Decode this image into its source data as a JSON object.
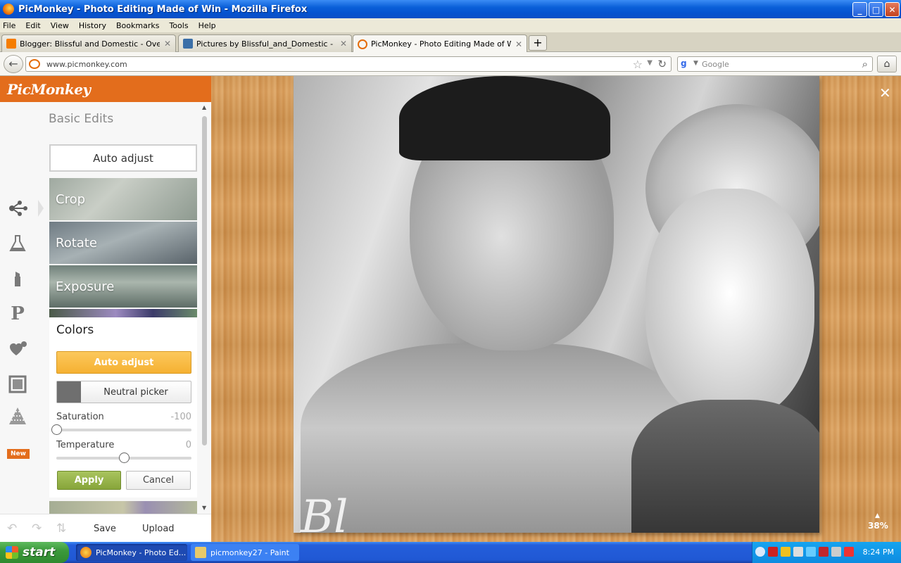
{
  "window": {
    "title": "PicMonkey - Photo Editing Made of Win - Mozilla Firefox",
    "minimize": "_",
    "maximize": "□",
    "close": "✕"
  },
  "menubar": [
    "File",
    "Edit",
    "View",
    "History",
    "Bookmarks",
    "Tools",
    "Help"
  ],
  "tabs": [
    {
      "label": "Blogger: Blissful and Domestic - Overview",
      "icon_color": "#f57d00",
      "close": "✕"
    },
    {
      "label": "Pictures by Blissful_and_Domestic - Phot...",
      "icon_color": "#3b6fa8",
      "close": "✕"
    },
    {
      "label": "PicMonkey - Photo Editing Made of Win",
      "icon_color": "#e46c0a",
      "close": "✕",
      "active": true
    }
  ],
  "newtab": "+",
  "navbar": {
    "url": "www.picmonkey.com",
    "search_placeholder": "Google"
  },
  "picmonkey": {
    "logo": "PicMonkey",
    "panel_title": "Basic Edits",
    "auto_adjust": "Auto adjust",
    "crop": "Crop",
    "rotate": "Rotate",
    "exposure": "Exposure",
    "colors": {
      "title": "Colors",
      "auto_adjust": "Auto adjust",
      "neutral_picker": "Neutral picker",
      "saturation_label": "Saturation",
      "saturation_value": "-100",
      "saturation_fraction": 0.0,
      "temperature_label": "Temperature",
      "temperature_value": "0",
      "temperature_fraction": 0.5,
      "apply": "Apply",
      "cancel": "Cancel"
    },
    "new_badge": "New",
    "bottom": {
      "save": "Save",
      "upload": "Upload"
    },
    "zoom": "38%",
    "close": "✕",
    "accent_color": "#e36d1c"
  },
  "taskbar": {
    "start": "start",
    "tasks": [
      "PicMonkey - Photo Ed...",
      "picmonkey27 - Paint"
    ],
    "clock": "8:24 PM"
  }
}
